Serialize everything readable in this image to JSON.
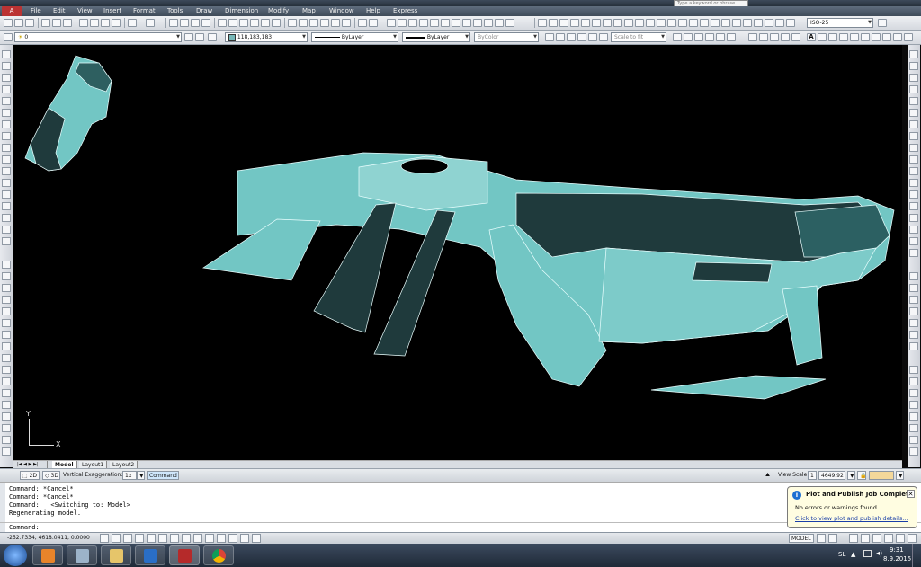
{
  "title_bar": {
    "search_placeholder": "Type a keyword or phrase"
  },
  "menu": {
    "items": [
      "File",
      "Edit",
      "View",
      "Insert",
      "Format",
      "Tools",
      "Draw",
      "Dimension",
      "Modify",
      "Map",
      "Window",
      "Help",
      "Express"
    ]
  },
  "toolbar1": {
    "dimstyle": "ISO-25"
  },
  "toolbar2": {
    "layer": "0",
    "color": "118,183,183",
    "linetype": "ByLayer",
    "lineweight": "ByLayer",
    "plotstyle": "ByColor",
    "scale": "Scale to fit"
  },
  "layout_tabs": [
    "Model",
    "Layout1",
    "Layout2"
  ],
  "status_row": {
    "mode_2d": "2D",
    "mode_3d": "3D",
    "vertical_exaggeration_label": "Vertical Exaggeration:",
    "vertical_exaggeration_value": "1x",
    "command_button": "Command",
    "view_scale_label": "View Scale",
    "view_scale_value": "1",
    "view_scale_number": "4649.92"
  },
  "command_history": [
    "Command: *Cancel*",
    "Command: *Cancel*",
    "Command:   <Switching to: Model>",
    "Regenerating model."
  ],
  "command_prompt": "Command:",
  "notification": {
    "title": "Plot and Publish Job Complete",
    "message": "No errors or warnings found",
    "link": "Click to view plot and publish details..."
  },
  "app_status": {
    "coordinates": "-252.7334, 4618.0411, 0.0000",
    "space": "MODEL"
  },
  "ucs": {
    "x_label": "X",
    "y_label": "Y"
  },
  "taskbar": {
    "language": "SL",
    "time": "9:31",
    "date": "8.9.2015"
  },
  "colors": {
    "model_fill": "#72c6c4",
    "model_dark": "#1f3a3c",
    "viewport_bg": "#000000"
  }
}
